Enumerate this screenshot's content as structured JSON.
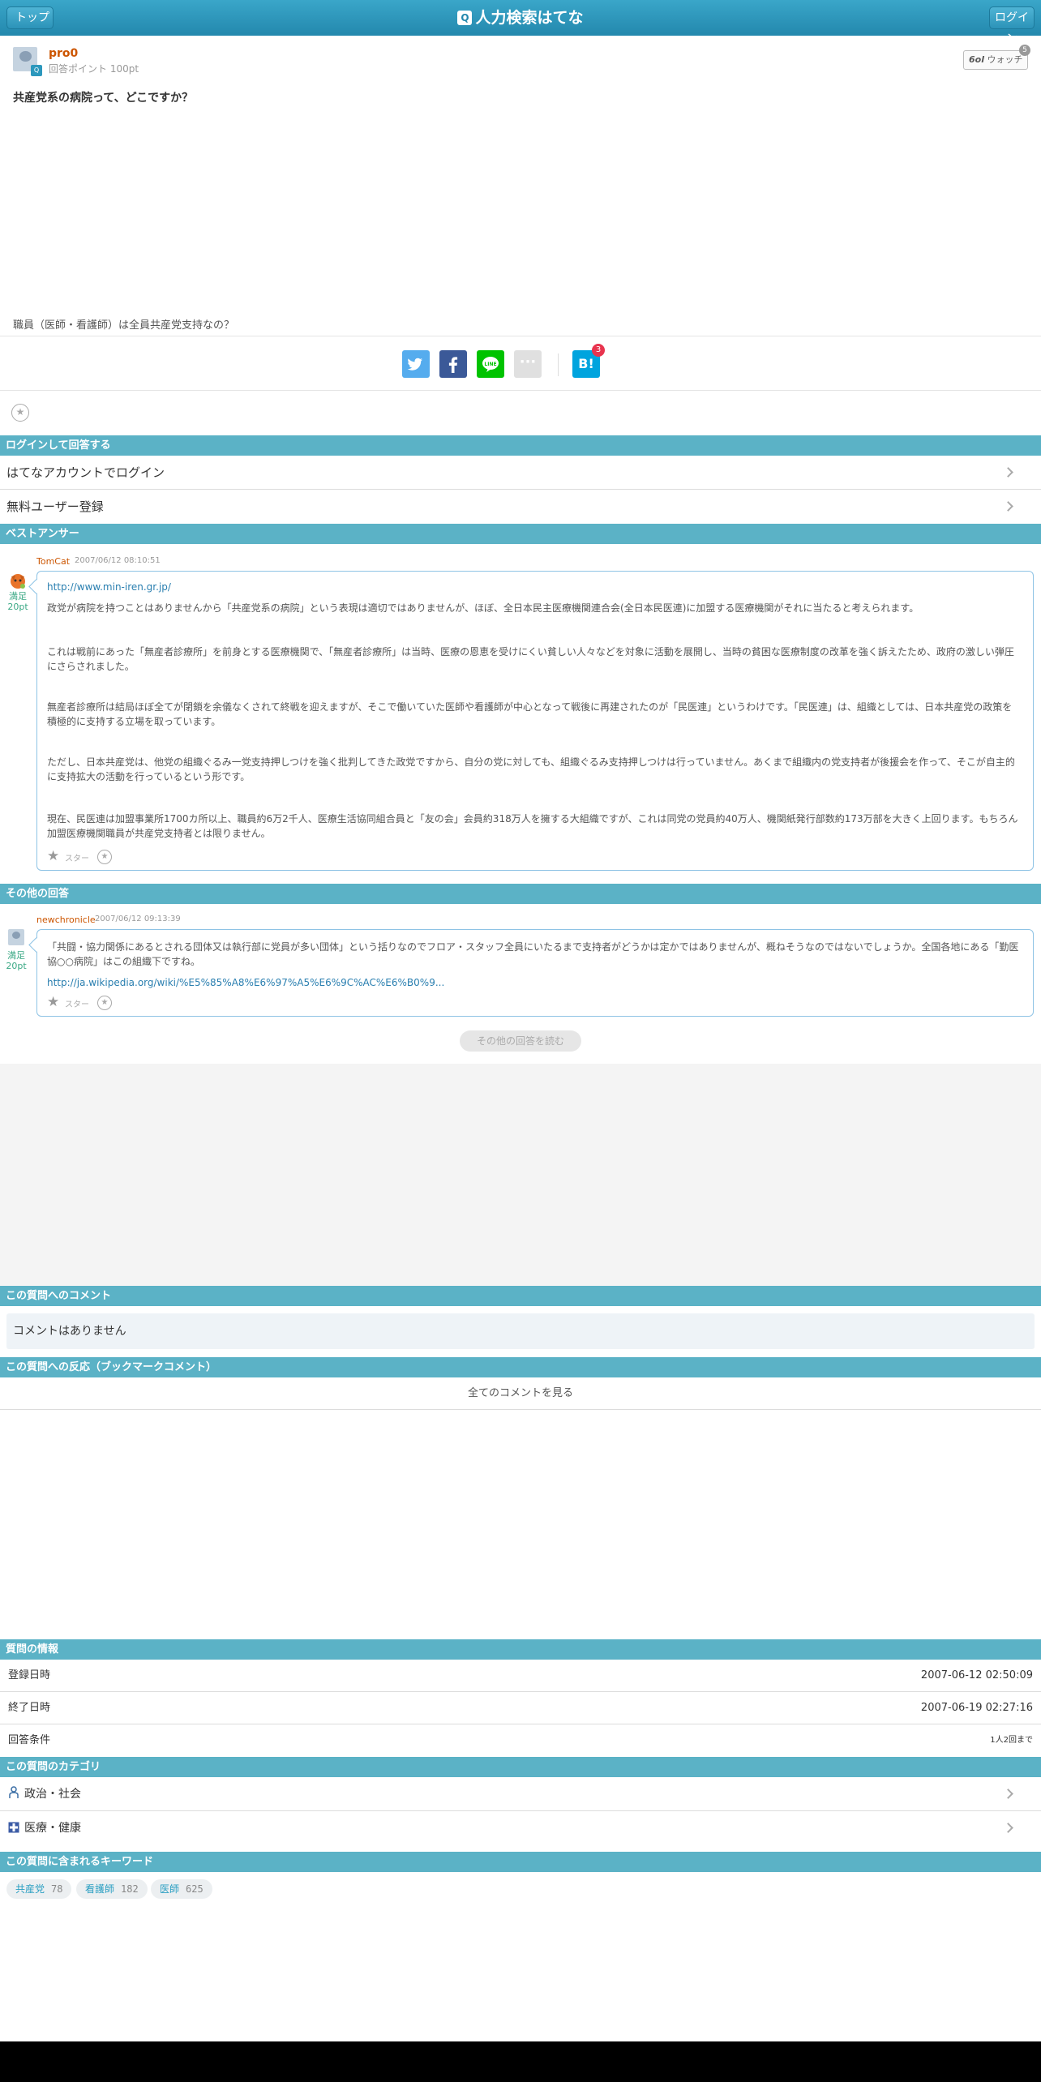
{
  "header": {
    "title": "人力検索はてな",
    "top_label": "トップ",
    "login_label": "ログイン",
    "logo_glyph": "Q"
  },
  "question": {
    "user": "pro0",
    "points": "回答ポイント 100pt",
    "watch_label": "ウォッチ",
    "watch_count": "5",
    "title": "共産党系の病院って、どこですか？",
    "body": "職員（医師・看護師）は全員共産党支持なの？",
    "bookmark_count": "3",
    "bookmark_label": "B!"
  },
  "login_section": {
    "heading": "ログインして回答する",
    "items": [
      "はてなアカウントでログイン",
      "無料ユーザー登録"
    ]
  },
  "best_answer": {
    "heading": "ベストアンサー",
    "user": "TomCat",
    "date": "2007/06/12 08:10:51",
    "satisfaction": "満足",
    "points": "20pt",
    "link": "http://www.min-iren.gr.jp/",
    "paragraphs": [
      "政党が病院を持つことはありませんから「共産党系の病院」という表現は適切ではありませんが、ほぼ、全日本民主医療機関連合会(全日本民医連)に加盟する医療機関がそれに当たると考えられます。",
      "これは戦前にあった「無産者診療所」を前身とする医療機関で、「無産者診療所」は当時、医療の恩恵を受けにくい貧しい人々などを対象に活動を展開し、当時の貧困な医療制度の改革を強く訴えたため、政府の激しい弾圧にさらされました。",
      "無産者診療所は結局ほぼ全てが閉鎖を余儀なくされて終戦を迎えますが、そこで働いていた医師や看護師が中心となって戦後に再建されたのが「民医連」というわけです。「民医連」は、組織としては、日本共産党の政策を積極的に支持する立場を取っています。",
      "ただし、日本共産党は、他党の組織ぐるみ一党支持押しつけを強く批判してきた政党ですから、自分の党に対しても、組織ぐるみ支持押しつけは行っていません。あくまで組織内の党支持者が後援会を作って、そこが自主的に支持拡大の活動を行っているという形です。",
      "現在、民医連は加盟事業所1700カ所以上、職員約6万2千人、医療生活協同組合員と「友の会」会員約318万人を擁する大組織ですが、これは同党の党員約40万人、機関紙発行部数約173万部を大きく上回ります。もちろん加盟医療機関職員が共産党支持者とは限りません。"
    ],
    "star_label": "スター"
  },
  "other_answers": {
    "heading": "その他の回答",
    "user": "newchronicle",
    "date": "2007/06/12 09:13:39",
    "satisfaction": "満足",
    "points": "20pt",
    "text": "「共闘・協力関係にあるとされる団体又は執行部に党員が多い団体」という括りなのでフロア・スタッフ全員にいたるまで支持者がどうかは定かではありませんが、概ねそうなのではないでしょうか。全国各地にある「勤医協○○病院」はこの組織下ですね。",
    "link": "http://ja.wikipedia.org/wiki/%E5%85%A8%E6%97%A5%E6%9C%AC%E6%B0%9...",
    "star_label": "スター",
    "more_label": "その他の回答を読む"
  },
  "comments": {
    "heading": "この質問へのコメント",
    "empty": "コメントはありません"
  },
  "reactions": {
    "heading": "この質問への反応（ブックマークコメント）",
    "all_label": "全てのコメントを見る"
  },
  "info": {
    "heading": "質問の情報",
    "rows": [
      {
        "label": "登録日時",
        "value": "2007-06-12 02:50:09"
      },
      {
        "label": "終了日時",
        "value": "2007-06-19 02:27:16"
      },
      {
        "label": "回答条件",
        "value": "1人2回まで"
      }
    ]
  },
  "categories": {
    "heading": "この質問のカテゴリ",
    "items": [
      {
        "label": "政治・社会",
        "icon": "person-icon"
      },
      {
        "label": "医療・健康",
        "icon": "medical-cross-icon"
      }
    ]
  },
  "keywords": {
    "heading": "この質問に含まれるキーワード",
    "items": [
      {
        "word": "共産党",
        "count": "78"
      },
      {
        "word": "看護師",
        "count": "182"
      },
      {
        "word": "医師",
        "count": "625"
      }
    ]
  },
  "colors": {
    "header": "#2c98bd",
    "section": "#5bb2c6",
    "username": "#cc5500",
    "link": "#2a7fb0"
  }
}
